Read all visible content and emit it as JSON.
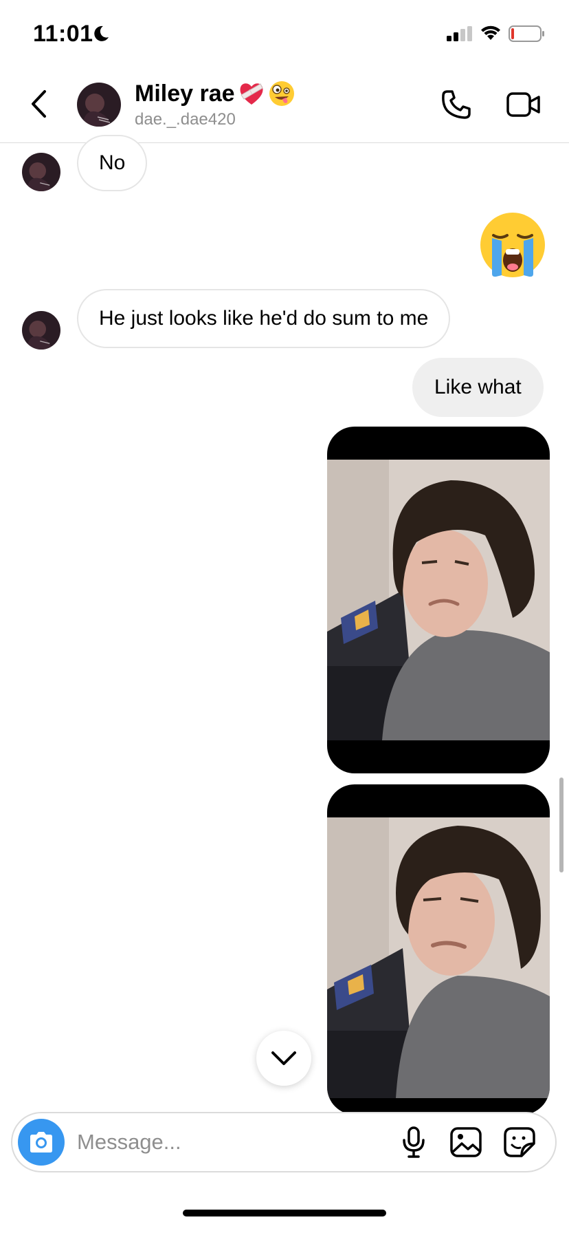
{
  "status_bar": {
    "time": "11:01",
    "icons": [
      "moon-icon",
      "signal-icon",
      "wifi-icon",
      "battery-icon"
    ]
  },
  "header": {
    "back_icon": "chevron-left-icon",
    "contact_name": "Miley rae",
    "name_emojis": [
      "bandaged-heart-emoji",
      "zany-face-emoji"
    ],
    "username": "dae._.dae420",
    "call_icon": "phone-icon",
    "video_icon": "video-camera-icon"
  },
  "messages": [
    {
      "direction": "incoming",
      "type": "text",
      "text": "No"
    },
    {
      "direction": "outgoing",
      "type": "emoji",
      "emoji": "loudly-crying-face-emoji"
    },
    {
      "direction": "incoming",
      "type": "text",
      "text": "He just looks like he'd do sum to me"
    },
    {
      "direction": "outgoing",
      "type": "text",
      "text": "Like what"
    },
    {
      "direction": "outgoing",
      "type": "photo",
      "content": "selfie-photo"
    },
    {
      "direction": "outgoing",
      "type": "photo",
      "content": "selfie-photo"
    }
  ],
  "jump_down_icon": "chevron-down-icon",
  "composer": {
    "placeholder": "Message...",
    "value": "",
    "icons": [
      "camera-icon",
      "microphone-icon",
      "image-icon",
      "sticker-icon"
    ]
  },
  "colors": {
    "accent_blue": "#3797f0",
    "outgoing_bubble": "#efefef",
    "incoming_border": "#e5e5e5",
    "secondary_text": "#8e8e8e"
  }
}
